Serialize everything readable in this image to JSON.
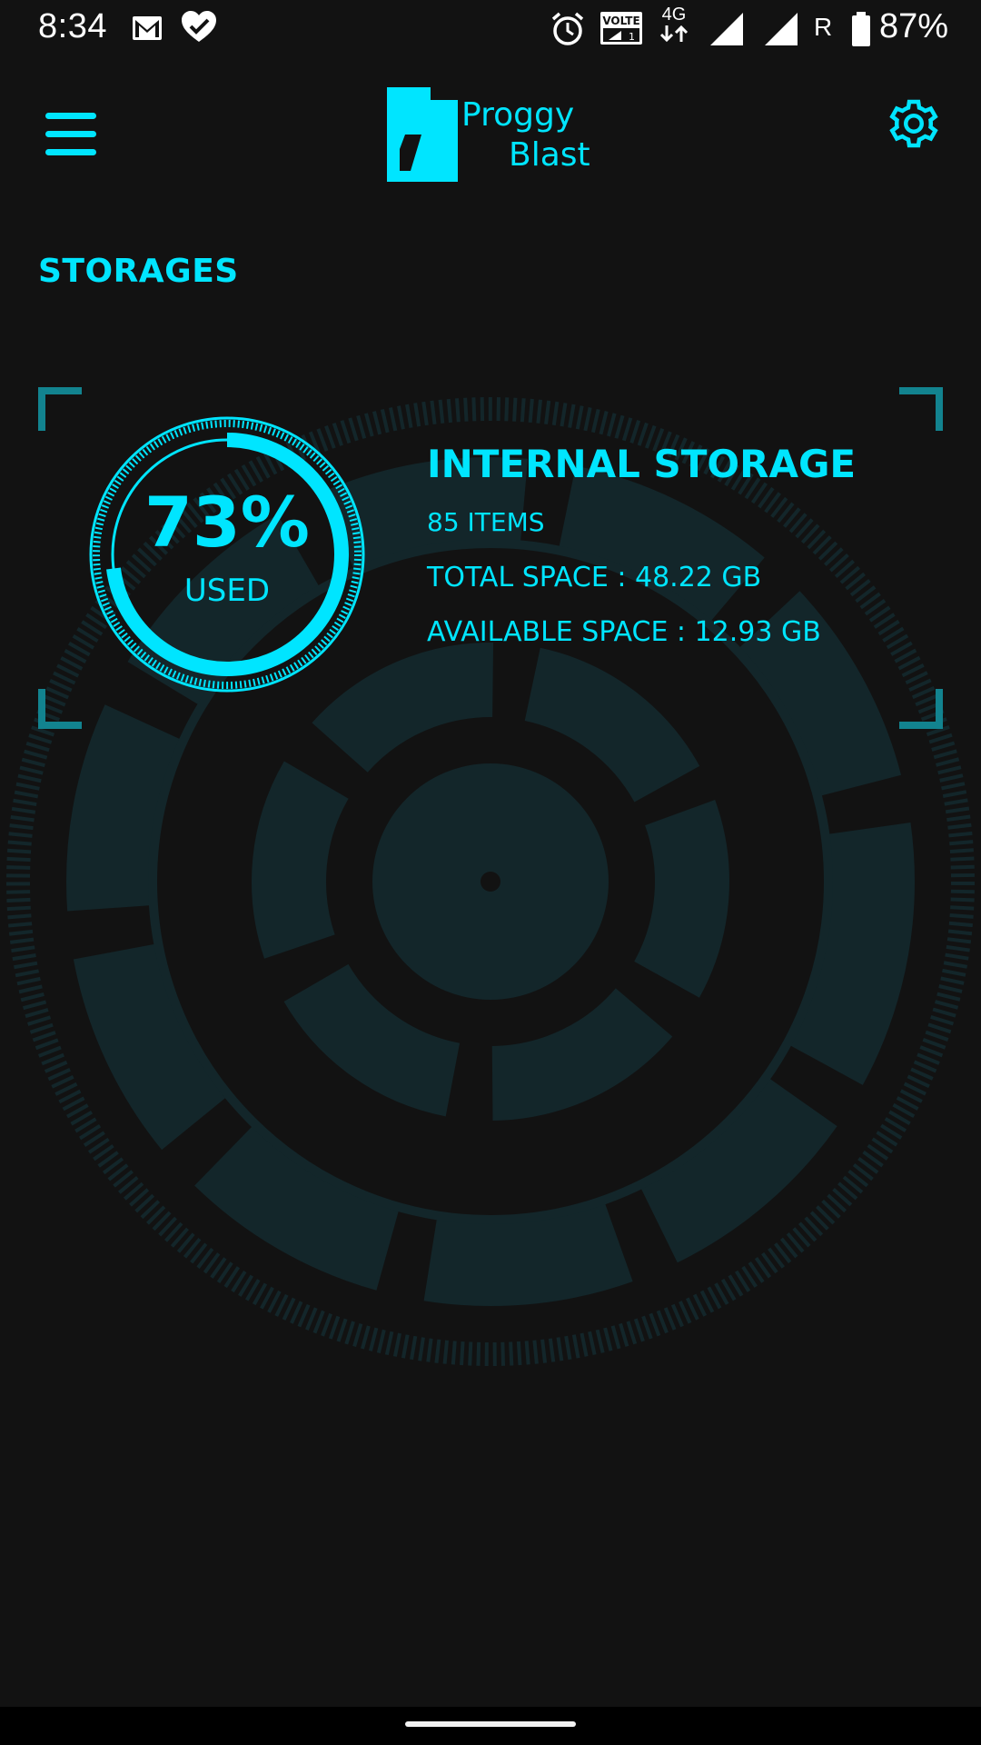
{
  "status_bar": {
    "time": "8:34",
    "network_type": "4G",
    "volte_label": "VOLTE",
    "roaming": "R",
    "battery": "87%",
    "icons": [
      "gmail-icon",
      "health-icon",
      "alarm-icon",
      "volte-icon",
      "4g-icon",
      "signal-icon",
      "signal-icon",
      "battery-icon"
    ]
  },
  "app_bar": {
    "logo_line1": "Proggy",
    "logo_line2": "Blast",
    "menu_icon": "hamburger-menu-icon",
    "settings_icon": "gear-icon"
  },
  "section": {
    "title": "STORAGES"
  },
  "storage": {
    "used_percent_label": "73%",
    "used_fraction": 0.73,
    "used_label": "USED",
    "name": "INTERNAL STORAGE",
    "items": "85 ITEMS",
    "total_space": "TOTAL SPACE : 48.22 GB",
    "available_space": "AVAILABLE SPACE : 12.93 GB"
  },
  "colors": {
    "accent": "#00e5ff",
    "background": "#121212",
    "hud": "#13262a"
  }
}
